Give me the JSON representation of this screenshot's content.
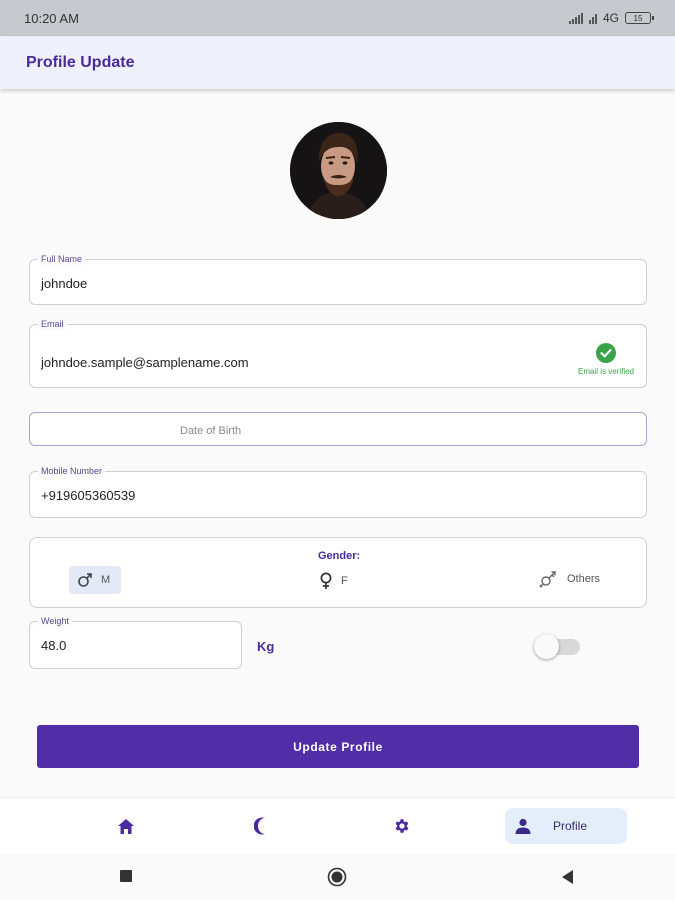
{
  "status_bar": {
    "time": "10:20 AM",
    "network": "4G",
    "battery": "15"
  },
  "app_bar": {
    "title": "Profile Update"
  },
  "avatar": {
    "icon": "avatar-photo"
  },
  "full_name": {
    "label": "Full Name",
    "value": "johndoe"
  },
  "email": {
    "label": "Email",
    "value": "johndoe.sample@samplename.com",
    "verified_text": "Email is verified",
    "verified_icon": "check-circle-icon",
    "verified_color": "#3aa348"
  },
  "dob": {
    "placeholder": "Date of Birth"
  },
  "mobile": {
    "label": "Mobile Number",
    "value": "+919605360539"
  },
  "gender": {
    "title": "Gender:",
    "options": [
      {
        "label": "M",
        "icon": "male-icon",
        "selected": true
      },
      {
        "label": "F",
        "icon": "female-icon",
        "selected": false
      },
      {
        "label": "Others",
        "icon": "transgender-icon",
        "selected": false
      }
    ]
  },
  "weight": {
    "label": "Weight",
    "value": "48.0",
    "unit": "Kg",
    "toggle_on": false
  },
  "update_button": {
    "label": "Update Profile"
  },
  "bottom_nav": {
    "items": [
      {
        "icon": "home-icon",
        "label": ""
      },
      {
        "icon": "moon-icon",
        "label": ""
      },
      {
        "icon": "gear-icon",
        "label": ""
      },
      {
        "icon": "person-icon",
        "label": "Profile",
        "active": true
      }
    ]
  },
  "system_nav": {
    "icons": [
      "square-icon",
      "circle-icon",
      "back-triangle-icon"
    ]
  },
  "colors": {
    "primary": "#512da8",
    "accent_text": "#4b2a9c",
    "app_bar_bg": "#eef0fb",
    "success": "#3aa348"
  }
}
